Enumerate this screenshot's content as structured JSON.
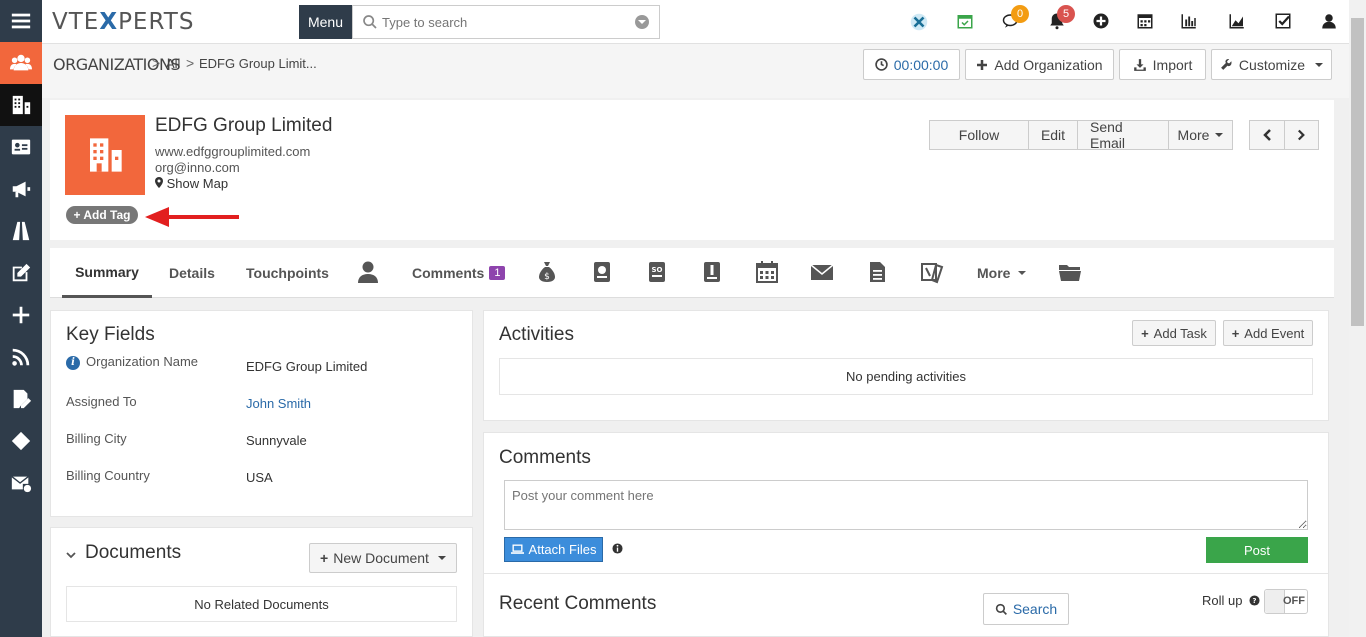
{
  "app": {
    "logo_left": "VTE",
    "logo_mid": "X",
    "logo_right": "PERTS"
  },
  "topbar": {
    "menu_label": "Menu",
    "search_placeholder": "Type to search",
    "chat_badge": "0",
    "notif_badge": "5"
  },
  "breadcrumb": {
    "module": "ORGANIZATIONS",
    "sep": ">",
    "filter": "All",
    "current": "EDFG Group Limit..."
  },
  "header_actions": {
    "timer": "00:00:00",
    "add_org": "Add Organization",
    "import": "Import",
    "customize": "Customize"
  },
  "record": {
    "name": "EDFG Group Limited",
    "website": "www.edfggrouplimited.com",
    "email": "org@inno.com",
    "show_map": "Show Map",
    "add_tag": "Add Tag"
  },
  "record_actions": {
    "follow": "Follow",
    "edit": "Edit",
    "send_email": "Send Email",
    "more": "More"
  },
  "tabs": {
    "summary": "Summary",
    "details": "Details",
    "touchpoints": "Touchpoints",
    "comments": "Comments",
    "comments_count": "1",
    "more": "More"
  },
  "key_fields": {
    "title": "Key Fields",
    "rows": [
      {
        "label": "Organization Name",
        "value": "EDFG Group Limited"
      },
      {
        "label": "Assigned To",
        "value": "John Smith"
      },
      {
        "label": "Billing City",
        "value": "Sunnyvale"
      },
      {
        "label": "Billing Country",
        "value": "USA"
      }
    ]
  },
  "documents": {
    "title": "Documents",
    "new_button": "New Document",
    "empty": "No Related Documents"
  },
  "activities": {
    "title": "Activities",
    "add_task": "Add Task",
    "add_event": "Add Event",
    "empty": "No pending activities"
  },
  "comments": {
    "title": "Comments",
    "placeholder": "Post your comment here",
    "attach": "Attach Files",
    "post": "Post",
    "recent_title": "Recent Comments",
    "search": "Search",
    "rollup": "Roll up",
    "toggle": "OFF"
  },
  "colors": {
    "accent": "#f2673c",
    "rail": "#2f3c4a",
    "link": "#2a6aa8",
    "post": "#3aa54a"
  }
}
